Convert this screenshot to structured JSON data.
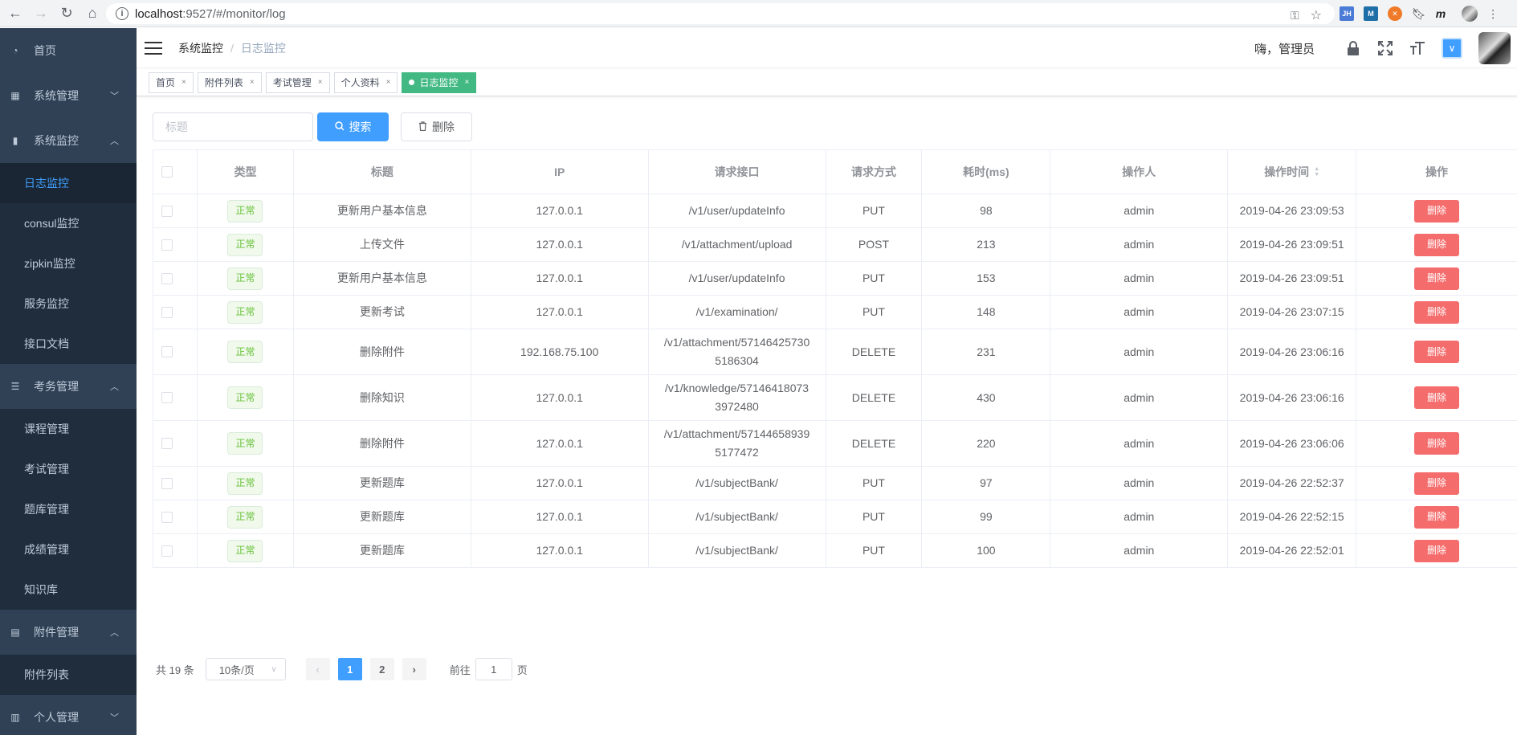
{
  "browser": {
    "url_host": "localhost",
    "url_path": ":9527/#/monitor/log",
    "extensions": [
      "JH",
      "M"
    ]
  },
  "sidebar": {
    "items": [
      {
        "type": "menu",
        "label": "首页",
        "icon": "dashboard-icon",
        "arrow": ""
      },
      {
        "type": "menu",
        "label": "系统管理",
        "icon": "grid-icon",
        "arrow": "﹀"
      },
      {
        "type": "menu",
        "label": "系统监控",
        "icon": "bar-chart-icon",
        "arrow": "︿"
      },
      {
        "type": "sub",
        "label": "日志监控",
        "active": true
      },
      {
        "type": "sub",
        "label": "consul监控"
      },
      {
        "type": "sub",
        "label": "zipkin监控"
      },
      {
        "type": "sub",
        "label": "服务监控"
      },
      {
        "type": "sub",
        "label": "接口文档"
      },
      {
        "type": "menu",
        "label": "考务管理",
        "icon": "list-icon",
        "arrow": "︿"
      },
      {
        "type": "sub",
        "label": "课程管理"
      },
      {
        "type": "sub",
        "label": "考试管理"
      },
      {
        "type": "sub",
        "label": "题库管理"
      },
      {
        "type": "sub",
        "label": "成绩管理"
      },
      {
        "type": "sub",
        "label": "知识库"
      },
      {
        "type": "menu",
        "label": "附件管理",
        "icon": "book-icon",
        "arrow": "︿"
      },
      {
        "type": "sub",
        "label": "附件列表"
      },
      {
        "type": "menu",
        "label": "个人管理",
        "icon": "document-icon",
        "arrow": "﹀"
      }
    ]
  },
  "header": {
    "breadcrumb": [
      "系统监控",
      "日志监控"
    ],
    "breadcrumb_sep": "/",
    "greeting": "嗨，管理员"
  },
  "tags": [
    {
      "label": "首页",
      "active": false
    },
    {
      "label": "附件列表",
      "active": false
    },
    {
      "label": "考试管理",
      "active": false
    },
    {
      "label": "个人资料",
      "active": false
    },
    {
      "label": "日志监控",
      "active": true
    }
  ],
  "toolbar": {
    "search_placeholder": "标题",
    "search_label": "搜索",
    "delete_label": "删除"
  },
  "table": {
    "columns": [
      "",
      "类型",
      "标题",
      "IP",
      "请求接口",
      "请求方式",
      "耗时(ms)",
      "操作人",
      "操作时间",
      "操作"
    ],
    "rows": [
      {
        "type": "正常",
        "title": "更新用户基本信息",
        "ip": "127.0.0.1",
        "uri": "/v1/user/updateInfo",
        "method": "PUT",
        "time": "98",
        "operator": "admin",
        "op_time": "2019-04-26 23:09:53",
        "action": "删除"
      },
      {
        "type": "正常",
        "title": "上传文件",
        "ip": "127.0.0.1",
        "uri": "/v1/attachment/upload",
        "method": "POST",
        "time": "213",
        "operator": "admin",
        "op_time": "2019-04-26 23:09:51",
        "action": "删除"
      },
      {
        "type": "正常",
        "title": "更新用户基本信息",
        "ip": "127.0.0.1",
        "uri": "/v1/user/updateInfo",
        "method": "PUT",
        "time": "153",
        "operator": "admin",
        "op_time": "2019-04-26 23:09:51",
        "action": "删除"
      },
      {
        "type": "正常",
        "title": "更新考试",
        "ip": "127.0.0.1",
        "uri": "/v1/examination/",
        "method": "PUT",
        "time": "148",
        "operator": "admin",
        "op_time": "2019-04-26 23:07:15",
        "action": "删除"
      },
      {
        "type": "正常",
        "title": "删除附件",
        "ip": "192.168.75.100",
        "uri": "/v1/attachment/571464257305186304",
        "method": "DELETE",
        "time": "231",
        "operator": "admin",
        "op_time": "2019-04-26 23:06:16",
        "action": "删除"
      },
      {
        "type": "正常",
        "title": "删除知识",
        "ip": "127.0.0.1",
        "uri": "/v1/knowledge/571464180733972480",
        "method": "DELETE",
        "time": "430",
        "operator": "admin",
        "op_time": "2019-04-26 23:06:16",
        "action": "删除"
      },
      {
        "type": "正常",
        "title": "删除附件",
        "ip": "127.0.0.1",
        "uri": "/v1/attachment/571446589395177472",
        "method": "DELETE",
        "time": "220",
        "operator": "admin",
        "op_time": "2019-04-26 23:06:06",
        "action": "删除"
      },
      {
        "type": "正常",
        "title": "更新题库",
        "ip": "127.0.0.1",
        "uri": "/v1/subjectBank/",
        "method": "PUT",
        "time": "97",
        "operator": "admin",
        "op_time": "2019-04-26 22:52:37",
        "action": "删除"
      },
      {
        "type": "正常",
        "title": "更新题库",
        "ip": "127.0.0.1",
        "uri": "/v1/subjectBank/",
        "method": "PUT",
        "time": "99",
        "operator": "admin",
        "op_time": "2019-04-26 22:52:15",
        "action": "删除"
      },
      {
        "type": "正常",
        "title": "更新题库",
        "ip": "127.0.0.1",
        "uri": "/v1/subjectBank/",
        "method": "PUT",
        "time": "100",
        "operator": "admin",
        "op_time": "2019-04-26 22:52:01",
        "action": "删除"
      }
    ]
  },
  "pagination": {
    "total": "共 19 条",
    "page_size": "10条/页",
    "pages": [
      "1",
      "2"
    ],
    "current": "1",
    "goto_prefix": "前往",
    "goto_value": "1",
    "goto_suffix": "页"
  },
  "colors": {
    "sidebar_bg": "#304156",
    "primary": "#409eff",
    "success": "#42b983",
    "danger": "#f56c6c"
  }
}
